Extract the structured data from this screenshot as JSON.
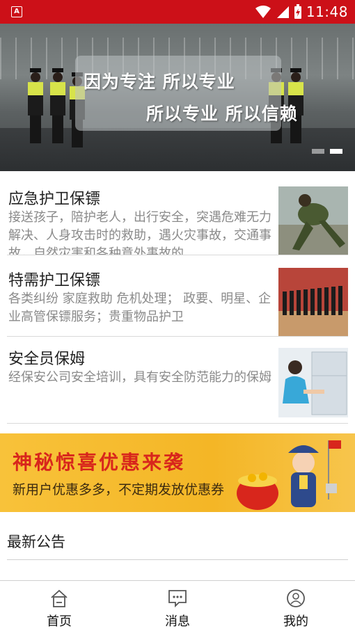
{
  "status_bar": {
    "time": "11:48",
    "background": "#cc1018"
  },
  "banner": {
    "line1": "因为专注 所以专业",
    "line2": "所以专业 所以信赖",
    "slide_count": 2,
    "active_slide": 2
  },
  "services": [
    {
      "title": "应急护卫保镖",
      "description": "接送孩子，陪护老人，出行安全，突遇危难无力解决、人身攻击时的救助，遇火灾事故，交通事故，自然灾害和各种意外事故的"
    },
    {
      "title": "特需护卫保镖",
      "description": "各类纠纷 家庭救助 危机处理； 政要、明星、企业高管保镖服务；贵重物品护卫"
    },
    {
      "title": "安全员保姆",
      "description": "经保安公司安全培训，具有安全防范能力的保姆"
    }
  ],
  "promo": {
    "title": "神秘惊喜优惠来袭",
    "subtitle": "新用户优惠多多，不定期发放优惠券"
  },
  "announcements": {
    "title": "最新公告"
  },
  "tabbar": [
    {
      "label": "首页",
      "icon": "home-icon"
    },
    {
      "label": "消息",
      "icon": "message-icon"
    },
    {
      "label": "我的",
      "icon": "profile-icon"
    }
  ],
  "colors": {
    "accent": "#cc1018",
    "promo_bg": "#f6bd32",
    "promo_title": "#d8261c",
    "muted_text": "#8a8a8a"
  }
}
